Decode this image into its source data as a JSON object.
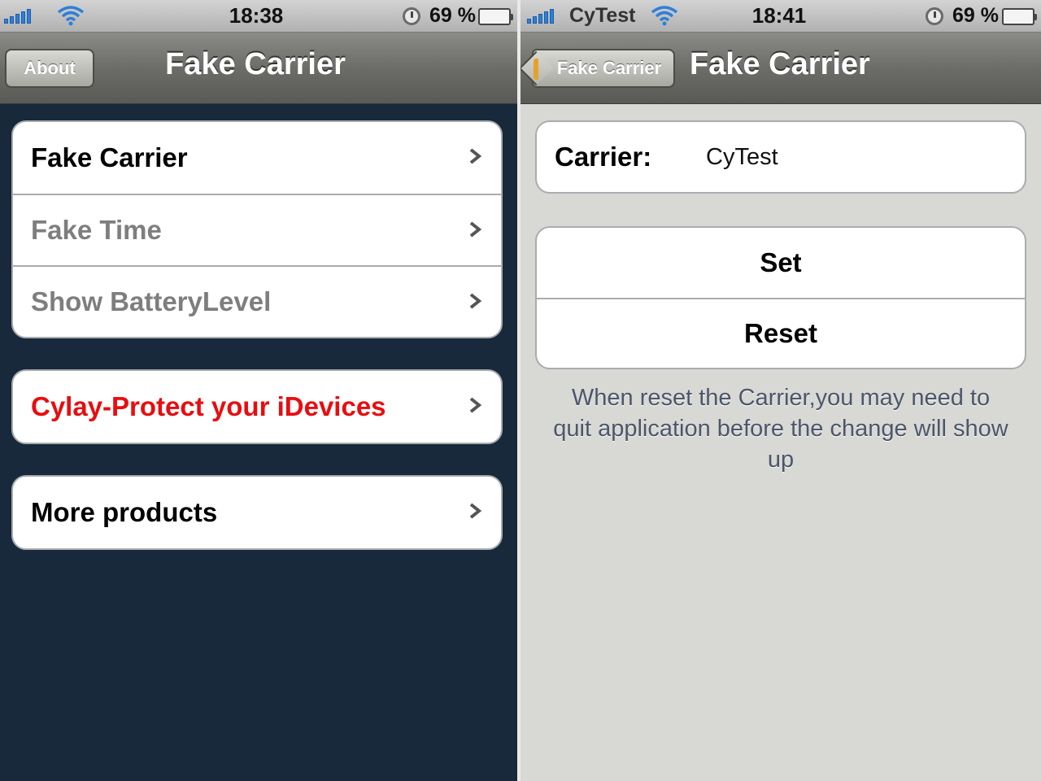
{
  "left_screen": {
    "status": {
      "time": "18:38",
      "battery_percent": "69 %",
      "battery_level": 0.69
    },
    "nav": {
      "title": "Fake Carrier",
      "about_button": "About"
    },
    "groups": [
      {
        "items": [
          {
            "label": "Fake Carrier"
          },
          {
            "label": "Fake Time"
          },
          {
            "label": "Show BatteryLevel"
          }
        ]
      },
      {
        "items": [
          {
            "label": "Cylay-Protect your iDevices"
          }
        ]
      },
      {
        "items": [
          {
            "label": "More products"
          }
        ]
      }
    ]
  },
  "right_screen": {
    "status": {
      "carrier": "CyTest",
      "time": "18:41",
      "battery_percent": "69 %",
      "battery_level": 0.69
    },
    "nav": {
      "title": "Fake Carrier",
      "back_button": "Fake Carrier"
    },
    "carrier_field": {
      "label": "Carrier:",
      "value": "CyTest"
    },
    "buttons": {
      "set": "Set",
      "reset": "Reset"
    },
    "footnote": "When reset the Carrier,you may need to quit application before the change will show up"
  },
  "colors": {
    "left_background": "#17293a",
    "right_background": "#d8d8d4",
    "highlight_red": "#e80d10",
    "signal_blue": "#2f7fd8",
    "battery_green": "#3fa312"
  },
  "icons": [
    "signal-bars-icon",
    "wifi-icon",
    "alarm-clock-icon",
    "battery-icon",
    "chevron-right-icon"
  ]
}
